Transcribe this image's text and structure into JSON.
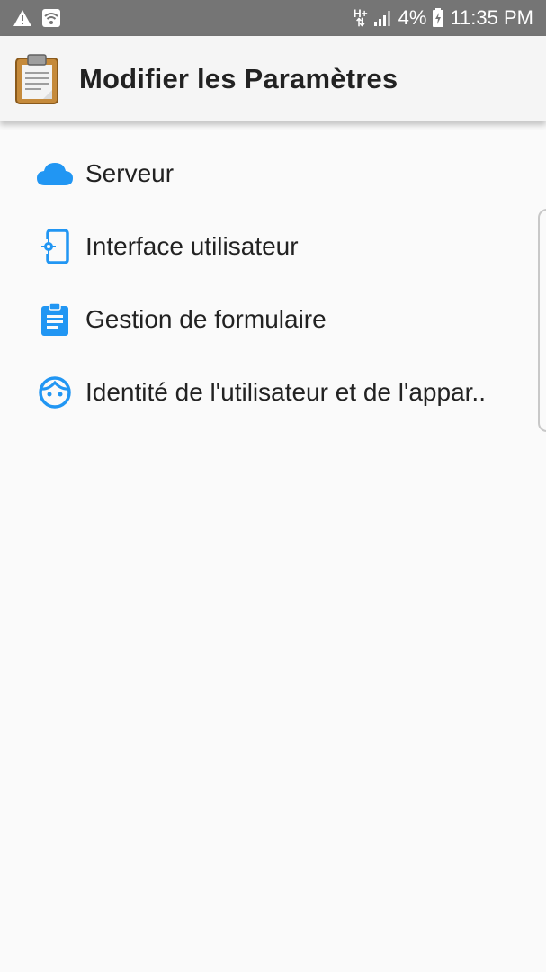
{
  "status_bar": {
    "network_label": "H+",
    "battery_percent": "4%",
    "time": "11:35 PM",
    "icons": [
      "warning-icon",
      "wifi-icon",
      "network-arrows-icon",
      "signal-icon",
      "battery-charging-icon"
    ]
  },
  "toolbar": {
    "title": "Modifier les Paramètres",
    "logo_icon": "clipboard-icon"
  },
  "menu": {
    "items": [
      {
        "label": "Serveur",
        "icon": "cloud-icon"
      },
      {
        "label": "Interface utilisateur",
        "icon": "phone-settings-icon"
      },
      {
        "label": "Gestion de formulaire",
        "icon": "clipboard-form-icon"
      },
      {
        "label": "Identité de l'utilisateur et de l'appar..",
        "icon": "face-icon"
      }
    ]
  },
  "colors": {
    "status_bar": "#757575",
    "toolbar": "#f5f5f5",
    "background": "#fafafa",
    "accent_blue": "#2196f3",
    "text": "#222222"
  }
}
